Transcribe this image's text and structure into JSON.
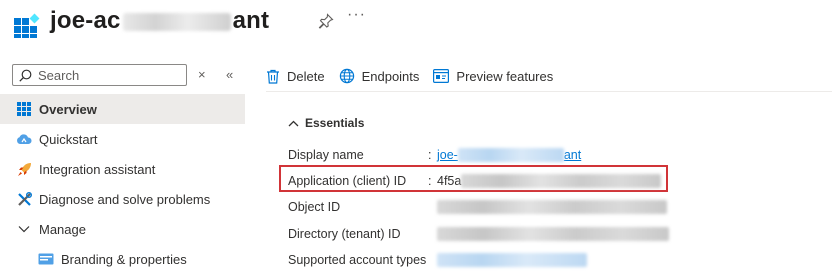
{
  "header": {
    "title_start": "joe-ac",
    "title_end": "ant",
    "pin_icon": "pin-icon",
    "more_icon": "more-icon",
    "more_label": "···"
  },
  "sidebar": {
    "search_placeholder": "Search",
    "collapse_label": "«",
    "clear_label": "×",
    "items": [
      {
        "label": "Overview",
        "icon": "grid-icon",
        "active": true
      },
      {
        "label": "Quickstart",
        "icon": "cloud-icon"
      },
      {
        "label": "Integration assistant",
        "icon": "rocket-icon"
      },
      {
        "label": "Diagnose and solve problems",
        "icon": "wrench-icon"
      },
      {
        "label": "Manage",
        "icon": "chevron-down-icon"
      },
      {
        "label": "Branding & properties",
        "icon": "branding-icon"
      }
    ]
  },
  "toolbar": {
    "delete_label": "Delete",
    "endpoints_label": "Endpoints",
    "preview_label": "Preview features"
  },
  "essentials": {
    "heading": "Essentials",
    "rows": [
      {
        "key": "Display name",
        "value_start": "joe-",
        "value_end": "ant"
      },
      {
        "key": "Application (client) ID",
        "value_start": "4f5a"
      },
      {
        "key": "Object ID"
      },
      {
        "key": "Directory (tenant) ID"
      },
      {
        "key": "Supported account types"
      }
    ]
  },
  "colors": {
    "accent": "#0078d4",
    "highlight": "#d13438",
    "active_nav": "#edebe9"
  }
}
